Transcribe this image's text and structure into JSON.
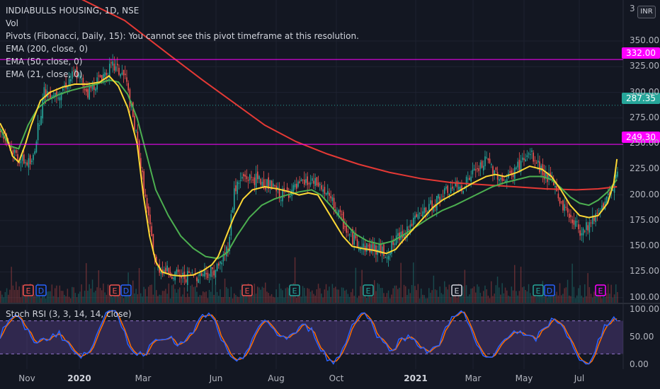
{
  "header": {
    "symbol_line": "INDIABULLS HOUSING, 1D, NSE",
    "vol": "Vol",
    "pivots": "Pivots (Fibonacci, Daily, 15): You cannot see this pivot timeframe at this resolution.",
    "ema200": "EMA (200, close, 0)",
    "ema50": "EMA (50, close, 0)",
    "ema21": "EMA (21, close, 0)",
    "currency": "INR"
  },
  "stoch_label": "Stoch RSI (3, 3, 14, 14, close)",
  "colors": {
    "background": "#131722",
    "up": "#26a69a",
    "down": "#ef5350",
    "ema200": "#e53935",
    "ema50": "#4caf50",
    "ema21": "#fdd835",
    "hline": "#ff00ff",
    "price_tag": "#26a69a",
    "stoch_k": "#2962ff",
    "stoch_d": "#ff6d00",
    "stoch_band": "#7e57c2"
  },
  "price_tags": {
    "last": "287.35",
    "level_high": "332.00",
    "level_low": "249.30"
  },
  "chart_data": {
    "type": "candlestick",
    "y_axis": {
      "ticks": [
        "350.00",
        "325.00",
        "300.00",
        "275.00",
        "250.00",
        "225.00",
        "200.00",
        "175.00",
        "150.00",
        "125.00",
        "100.00"
      ],
      "top_partial": "3"
    },
    "x_axis": {
      "labels": [
        "Nov",
        "2020",
        "Mar",
        "Jun",
        "Aug",
        "Oct",
        "2021",
        "Mar",
        "May",
        "Jul"
      ],
      "bold": [
        "2020",
        "2021"
      ]
    },
    "ylim": [
      95,
      390
    ],
    "horizontal_levels": [
      332.0,
      249.3
    ],
    "last_price": 287.35,
    "close_points": [
      [
        0,
        265
      ],
      [
        5,
        250
      ],
      [
        12,
        235
      ],
      [
        20,
        230
      ],
      [
        28,
        300
      ],
      [
        38,
        300
      ],
      [
        48,
        320
      ],
      [
        56,
        300
      ],
      [
        64,
        315
      ],
      [
        72,
        325
      ],
      [
        80,
        315
      ],
      [
        88,
        250
      ],
      [
        94,
        185
      ],
      [
        100,
        130
      ],
      [
        108,
        125
      ],
      [
        116,
        120
      ],
      [
        126,
        122
      ],
      [
        134,
        125
      ],
      [
        140,
        130
      ],
      [
        146,
        150
      ],
      [
        150,
        205
      ],
      [
        156,
        218
      ],
      [
        164,
        215
      ],
      [
        172,
        210
      ],
      [
        180,
        200
      ],
      [
        188,
        205
      ],
      [
        196,
        212
      ],
      [
        204,
        210
      ],
      [
        212,
        195
      ],
      [
        218,
        178
      ],
      [
        224,
        160
      ],
      [
        232,
        150
      ],
      [
        240,
        148
      ],
      [
        248,
        143
      ],
      [
        256,
        160
      ],
      [
        264,
        172
      ],
      [
        272,
        183
      ],
      [
        280,
        195
      ],
      [
        288,
        205
      ],
      [
        296,
        208
      ],
      [
        304,
        222
      ],
      [
        312,
        233
      ],
      [
        318,
        222
      ],
      [
        324,
        213
      ],
      [
        332,
        228
      ],
      [
        340,
        240
      ],
      [
        348,
        222
      ],
      [
        354,
        213
      ],
      [
        360,
        192
      ],
      [
        366,
        178
      ],
      [
        372,
        165
      ],
      [
        378,
        172
      ],
      [
        386,
        190
      ],
      [
        392,
        200
      ],
      [
        396,
        225
      ]
    ],
    "ema21_points": [
      [
        0,
        270
      ],
      [
        4,
        258
      ],
      [
        8,
        238
      ],
      [
        12,
        232
      ],
      [
        16,
        248
      ],
      [
        20,
        268
      ],
      [
        26,
        292
      ],
      [
        32,
        300
      ],
      [
        40,
        305
      ],
      [
        48,
        308
      ],
      [
        56,
        308
      ],
      [
        64,
        310
      ],
      [
        70,
        316
      ],
      [
        76,
        306
      ],
      [
        82,
        285
      ],
      [
        88,
        250
      ],
      [
        92,
        200
      ],
      [
        96,
        160
      ],
      [
        100,
        135
      ],
      [
        104,
        125
      ],
      [
        110,
        122
      ],
      [
        116,
        121
      ],
      [
        124,
        122
      ],
      [
        130,
        126
      ],
      [
        136,
        132
      ],
      [
        140,
        140
      ],
      [
        144,
        155
      ],
      [
        150,
        178
      ],
      [
        156,
        196
      ],
      [
        162,
        205
      ],
      [
        170,
        208
      ],
      [
        178,
        206
      ],
      [
        186,
        203
      ],
      [
        192,
        200
      ],
      [
        198,
        202
      ],
      [
        204,
        200
      ],
      [
        208,
        190
      ],
      [
        214,
        175
      ],
      [
        220,
        160
      ],
      [
        226,
        150
      ],
      [
        232,
        148
      ],
      [
        240,
        146
      ],
      [
        248,
        143
      ],
      [
        254,
        147
      ],
      [
        260,
        158
      ],
      [
        266,
        168
      ],
      [
        272,
        178
      ],
      [
        278,
        188
      ],
      [
        284,
        195
      ],
      [
        290,
        200
      ],
      [
        296,
        205
      ],
      [
        304,
        212
      ],
      [
        312,
        218
      ],
      [
        318,
        220
      ],
      [
        324,
        218
      ],
      [
        332,
        222
      ],
      [
        340,
        228
      ],
      [
        348,
        225
      ],
      [
        354,
        218
      ],
      [
        360,
        205
      ],
      [
        366,
        190
      ],
      [
        372,
        180
      ],
      [
        378,
        178
      ],
      [
        384,
        180
      ],
      [
        390,
        192
      ],
      [
        394,
        212
      ],
      [
        396,
        235
      ]
    ],
    "ema50_points": [
      [
        0,
        265
      ],
      [
        6,
        248
      ],
      [
        12,
        245
      ],
      [
        18,
        268
      ],
      [
        24,
        284
      ],
      [
        30,
        292
      ],
      [
        38,
        298
      ],
      [
        46,
        302
      ],
      [
        54,
        305
      ],
      [
        62,
        308
      ],
      [
        70,
        312
      ],
      [
        76,
        310
      ],
      [
        82,
        298
      ],
      [
        88,
        275
      ],
      [
        94,
        240
      ],
      [
        100,
        205
      ],
      [
        108,
        180
      ],
      [
        116,
        160
      ],
      [
        124,
        148
      ],
      [
        132,
        140
      ],
      [
        140,
        138
      ],
      [
        146,
        144
      ],
      [
        152,
        160
      ],
      [
        160,
        178
      ],
      [
        168,
        190
      ],
      [
        176,
        196
      ],
      [
        184,
        200
      ],
      [
        192,
        203
      ],
      [
        200,
        205
      ],
      [
        206,
        200
      ],
      [
        212,
        190
      ],
      [
        220,
        175
      ],
      [
        228,
        162
      ],
      [
        236,
        155
      ],
      [
        244,
        152
      ],
      [
        252,
        155
      ],
      [
        260,
        162
      ],
      [
        268,
        170
      ],
      [
        276,
        178
      ],
      [
        284,
        185
      ],
      [
        292,
        190
      ],
      [
        300,
        196
      ],
      [
        308,
        202
      ],
      [
        316,
        208
      ],
      [
        324,
        212
      ],
      [
        332,
        215
      ],
      [
        340,
        218
      ],
      [
        348,
        218
      ],
      [
        354,
        215
      ],
      [
        360,
        207
      ],
      [
        366,
        198
      ],
      [
        372,
        192
      ],
      [
        378,
        190
      ],
      [
        384,
        195
      ],
      [
        390,
        203
      ],
      [
        396,
        215
      ]
    ],
    "ema200_points": [
      [
        0,
        430
      ],
      [
        40,
        400
      ],
      [
        80,
        370
      ],
      [
        110,
        335
      ],
      [
        130,
        312
      ],
      [
        150,
        290
      ],
      [
        170,
        268
      ],
      [
        190,
        252
      ],
      [
        210,
        240
      ],
      [
        230,
        230
      ],
      [
        250,
        222
      ],
      [
        270,
        216
      ],
      [
        290,
        212
      ],
      [
        310,
        210
      ],
      [
        330,
        208
      ],
      [
        350,
        206
      ],
      [
        370,
        205
      ],
      [
        384,
        206
      ],
      [
        396,
        208
      ]
    ],
    "stoch_rsi": {
      "ylim": [
        0,
        100
      ],
      "ticks": [
        "100.00",
        "50.00",
        "0.00"
      ],
      "bands": [
        80,
        20
      ]
    }
  }
}
